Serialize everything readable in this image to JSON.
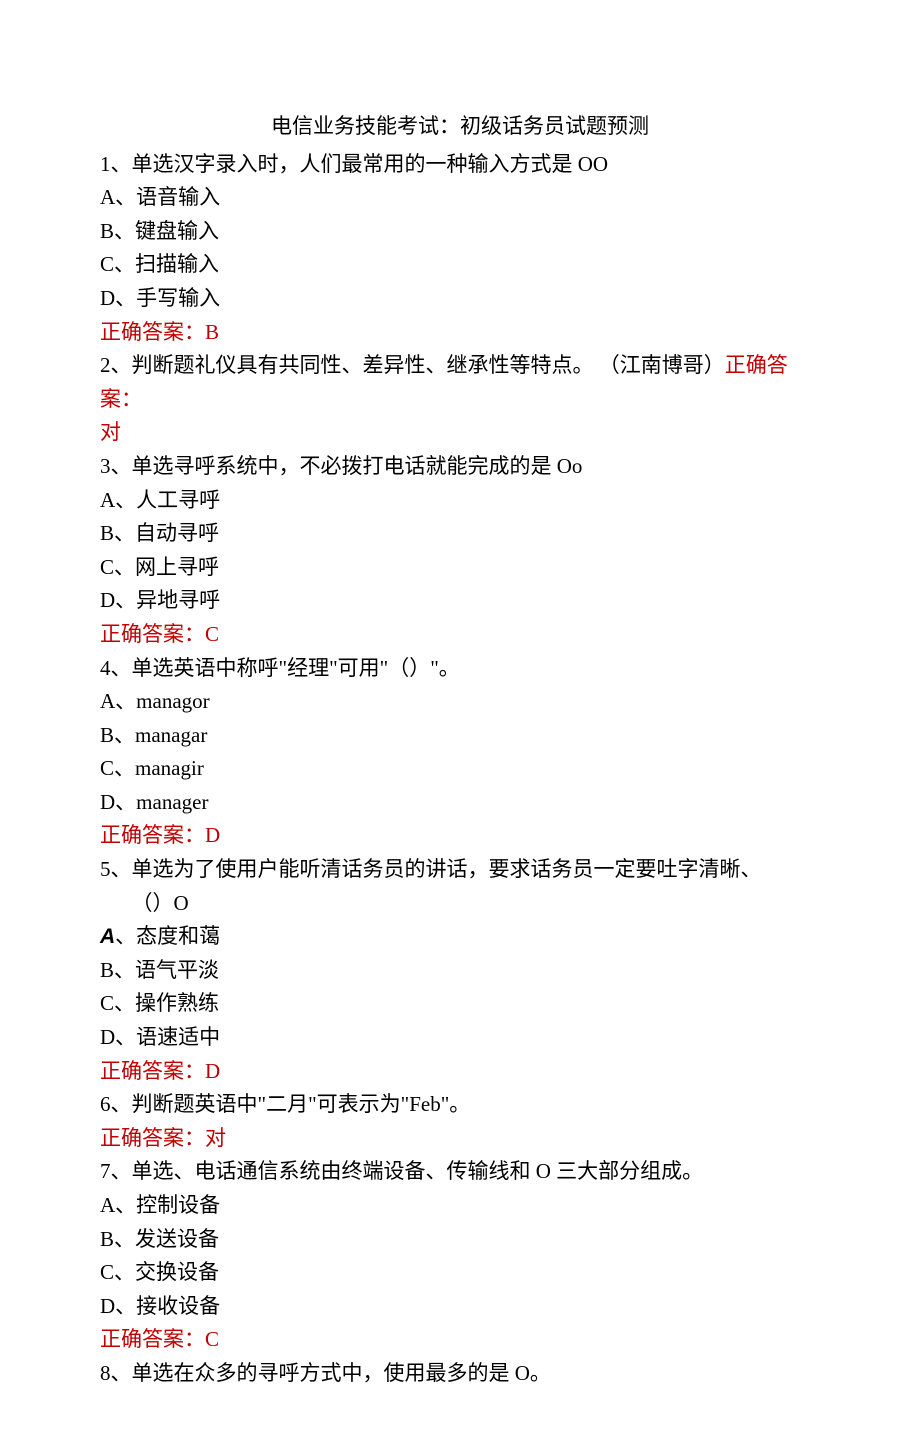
{
  "title": "电信业务技能考试：初级话务员试题预测",
  "q1": {
    "stem": "1、单选汉字录入时，人们最常用的一种输入方式是 OO",
    "A": "A、语音输入",
    "B": "B、键盘输入",
    "C": "C、扫描输入",
    "D": "D、手写输入",
    "ans": "正确答案：B"
  },
  "q2": {
    "stem_pre": "2、判断题礼仪具有共同性、差异性、继承性等特点。 （江南博哥）",
    "ans_inline": "正确答案：",
    "ans_cont": "对"
  },
  "q3": {
    "stem": "3、单选寻呼系统中，不必拨打电话就能完成的是 Oo",
    "A": "A、人工寻呼",
    "B": "B、自动寻呼",
    "C": "C、网上寻呼",
    "D": "D、异地寻呼",
    "ans": "正确答案：C"
  },
  "q4": {
    "stem": "4、单选英语中称呼\"经理\"可用\"（）\"。",
    "A_pre": "A、",
    "A_val": "managor",
    "B_pre": "B、",
    "B_val": "managar",
    "C_pre": "C、",
    "C_val": "managir",
    "D_pre": "D、",
    "D_val": "manager",
    "ans": "正确答案：D"
  },
  "q5": {
    "stem": "5、单选为了使用户能听清话务员的讲话，要求话务员一定要吐字清晰、",
    "stem2": "（）O",
    "A_pre": "A",
    "A_val": "、态度和蔼",
    "B": "B、语气平淡",
    "C": "C、操作熟练",
    "D": "D、语速适中",
    "ans": "正确答案：D"
  },
  "q6": {
    "stem": "6、判断题英语中\"二月\"可表示为\"Feb\"。",
    "ans": "正确答案：对"
  },
  "q7": {
    "stem": "7、单选、电话通信系统由终端设备、传输线和 O 三大部分组成。",
    "A": "A、控制设备",
    "B": "B、发送设备",
    "C": "C、交换设备",
    "D": "D、接收设备",
    "ans": "正确答案：C"
  },
  "q8": {
    "stem": "8、单选在众多的寻呼方式中，使用最多的是 O。"
  }
}
